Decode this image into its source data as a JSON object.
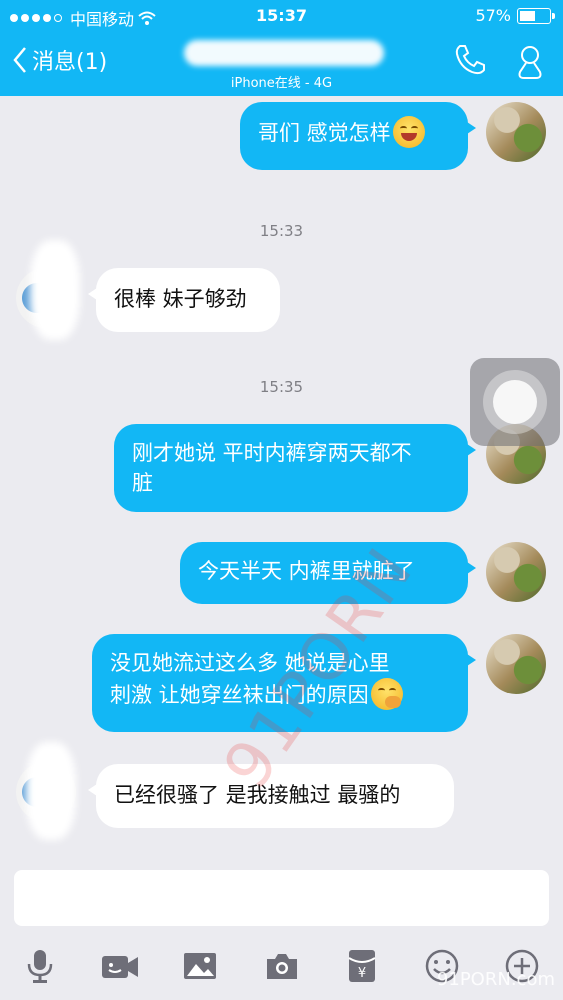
{
  "status_bar": {
    "carrier": "中国移动",
    "time": "15:37",
    "battery_text": "57%",
    "battery_level": 0.57
  },
  "header": {
    "back_label": "消息(1)",
    "subtitle": "iPhone在线 - 4G"
  },
  "timestamps": [
    "15:33",
    "15:35"
  ],
  "messages": [
    {
      "side": "right",
      "text": "哥们 感觉怎样",
      "emoji": "grin-emoji"
    },
    {
      "side": "left",
      "text": "很棒 妹子够劲"
    },
    {
      "side": "right",
      "line1": "刚才她说 平时内裤穿两天都不",
      "line2": "脏"
    },
    {
      "side": "right",
      "text": "今天半天 内裤里就脏了"
    },
    {
      "side": "right",
      "line1": "没见她流过这么多 她说是心里",
      "line2": "刺激 让她穿丝袜出门的原因",
      "emoji": "hand-over-mouth-emoji"
    },
    {
      "side": "left",
      "text": "已经很骚了 是我接触过 最骚的"
    }
  ],
  "watermark": "91PORN",
  "watermark_corner": "91PORN.com",
  "toolbar_icons": [
    "microphone-icon",
    "video-icon",
    "image-icon",
    "camera-icon",
    "red-packet-icon",
    "emoji-icon",
    "plus-icon"
  ],
  "colors": {
    "accent": "#12b7f5",
    "background": "#ebebf0",
    "incoming_bubble": "#ffffff"
  }
}
